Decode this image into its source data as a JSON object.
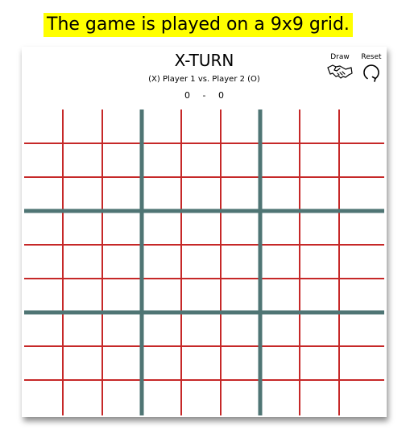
{
  "caption": "The game is played on a 9x9 grid.",
  "game": {
    "title": "X-TURN",
    "subtitle": "(X) Player 1 vs. Player 2 (O)",
    "score": {
      "player1": "0",
      "separator": "-",
      "player2": "0"
    }
  },
  "controls": {
    "draw_label": "Draw",
    "draw_icon": "handshake-icon",
    "reset_label": "Reset",
    "reset_icon": "reset-icon"
  },
  "board": {
    "rows": 9,
    "cols": 9,
    "cell_line_color": "#c62828",
    "block_line_color": "#4f7574"
  }
}
